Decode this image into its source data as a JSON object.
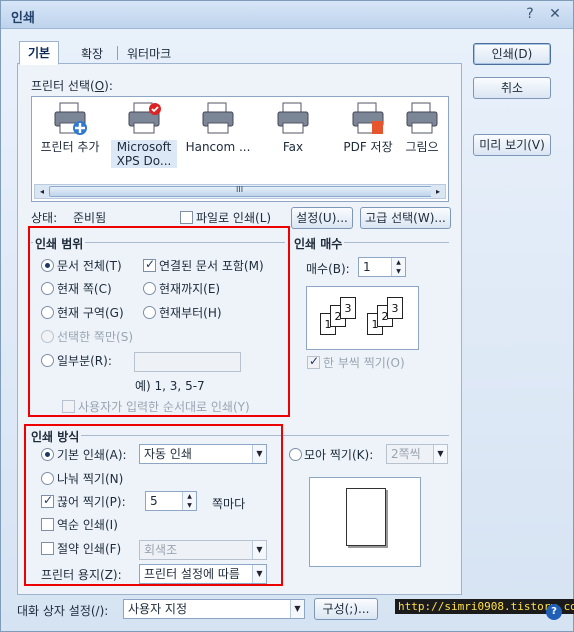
{
  "window": {
    "title": "인쇄",
    "help_label": "?",
    "close_label": "✕"
  },
  "tabs": [
    {
      "label": "기본"
    },
    {
      "label": "확장"
    },
    {
      "label": "워터마크"
    }
  ],
  "printer_select": {
    "label_prefix": "프린터 선택(",
    "label_key": "O",
    "label_suffix": "):",
    "printers": [
      {
        "name": "프린터 추가",
        "icon": "add-printer-icon"
      },
      {
        "name": "Microsoft XPS Do...",
        "icon": "printer-default-icon"
      },
      {
        "name": "Hancom ...",
        "icon": "printer-icon"
      },
      {
        "name": "Fax",
        "icon": "fax-icon"
      },
      {
        "name": "PDF 저장",
        "icon": "pdf-printer-icon"
      },
      {
        "name": "그림으",
        "icon": "image-printer-icon"
      }
    ],
    "scroll_left": "◂",
    "scroll_right": "▸",
    "scroll_grip": "III"
  },
  "status": {
    "label": "상태:",
    "value": "준비됨",
    "print_to_file": "파일로 인쇄(L)",
    "settings_btn": "설정(U)...",
    "advanced_btn": "고급 선택(W)..."
  },
  "buttons": {
    "print": "인쇄(D)",
    "cancel": "취소",
    "preview": "미리 보기(V)"
  },
  "print_range": {
    "title": "인쇄 범위",
    "all": "문서 전체(T)",
    "linked": "연결된 문서 포함(M)",
    "current_page": "현재 쪽(C)",
    "until_current": "현재까지(E)",
    "current_section": "현재 구역(G)",
    "from_current": "현재부터(H)",
    "selection": "선택한 쪽만(S)",
    "partial": "일부분(R):",
    "partial_example": "예) 1, 3, 5-7",
    "user_order": "사용자가 입력한 순서대로 인쇄(Y)"
  },
  "copies": {
    "title": "인쇄 매수",
    "label": "매수(B):",
    "value": "1",
    "collate": "한 부씩 찍기(O)",
    "collate_pages": [
      "1",
      "2",
      "3",
      "1",
      "2",
      "3"
    ]
  },
  "print_method": {
    "title": "인쇄 방식",
    "default_print": "기본 인쇄(A):",
    "default_value": "자동 인쇄",
    "split": "나눠 찍기(N)",
    "cut": "끊어 찍기(P):",
    "cut_value": "5",
    "cut_suffix": "쪽마다",
    "reverse": "역순 인쇄(I)",
    "save": "절약 인쇄(F)",
    "save_value": "회색조",
    "paper": "프린터 용지(Z):",
    "paper_value": "프린터 설정에 따름",
    "multi": "모아 찍기(K):",
    "multi_value": "2쪽씩"
  },
  "dialog_settings": {
    "label": "대화 상자 설정(/):",
    "value": "사용자 지정",
    "config_btn": "구성(;)..."
  },
  "watermark_url": "http://simri0908.tistory.com",
  "colors": {
    "highlight_box": "#e00000",
    "accent": "#1b3b66"
  }
}
